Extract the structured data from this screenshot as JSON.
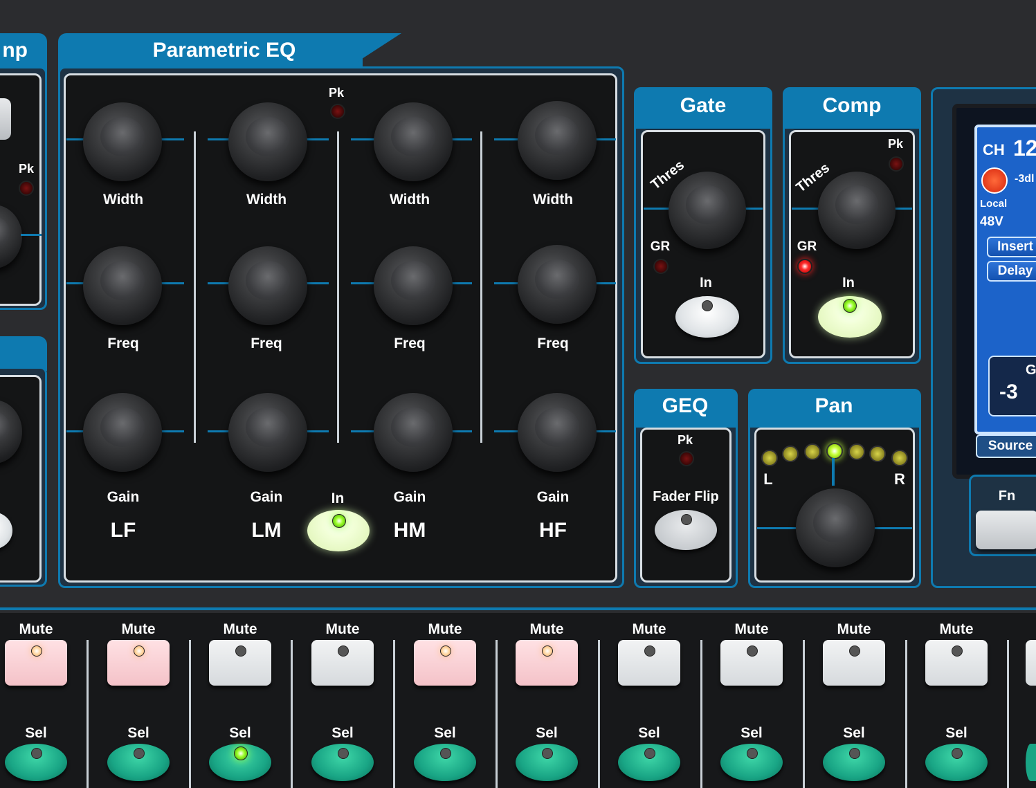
{
  "left_section": {
    "title_fragment": "np",
    "pk_label": "Pk"
  },
  "parametric_eq": {
    "title": "Parametric EQ",
    "pk_label": "Pk",
    "in_label": "In",
    "bands": [
      {
        "name": "LF",
        "width_label": "Width",
        "freq_label": "Freq",
        "gain_label": "Gain"
      },
      {
        "name": "LM",
        "width_label": "Width",
        "freq_label": "Freq",
        "gain_label": "Gain"
      },
      {
        "name": "HM",
        "width_label": "Width",
        "freq_label": "Freq",
        "gain_label": "Gain"
      },
      {
        "name": "HF",
        "width_label": "Width",
        "freq_label": "Freq",
        "gain_label": "Gain"
      }
    ]
  },
  "gate": {
    "title": "Gate",
    "thres_label": "Thres",
    "gr_label": "GR",
    "in_label": "In"
  },
  "comp": {
    "title": "Comp",
    "pk_label": "Pk",
    "thres_label": "Thres",
    "gr_label": "GR",
    "in_label": "In"
  },
  "geq": {
    "title": "GEQ",
    "pk_label": "Pk",
    "fader_flip_label": "Fader Flip"
  },
  "pan": {
    "title": "Pan",
    "left_label": "L",
    "right_label": "R",
    "meter_leds": 7,
    "active_led": 4
  },
  "display": {
    "ch_label": "CH",
    "ch_number": "12",
    "gain_readout": "-3dl",
    "local_label": "Local",
    "phantom_label": "48V",
    "insert_label": "Insert",
    "delay_label": "Delay",
    "gain_label": "Ga",
    "gain_value": "-3",
    "source_label": "Source",
    "fn_label": "Fn",
    "colors": {
      "lcd_bg": "#1c63c9",
      "knob": "#e2391a"
    }
  },
  "strips": [
    {
      "mute_label": "Mute",
      "sel_label": "Sel",
      "mute_on": true,
      "sel_on": false
    },
    {
      "mute_label": "Mute",
      "sel_label": "Sel",
      "mute_on": true,
      "sel_on": false
    },
    {
      "mute_label": "Mute",
      "sel_label": "Sel",
      "mute_on": false,
      "sel_on": true
    },
    {
      "mute_label": "Mute",
      "sel_label": "Sel",
      "mute_on": false,
      "sel_on": false
    },
    {
      "mute_label": "Mute",
      "sel_label": "Sel",
      "mute_on": true,
      "sel_on": false
    },
    {
      "mute_label": "Mute",
      "sel_label": "Sel",
      "mute_on": true,
      "sel_on": false
    },
    {
      "mute_label": "Mute",
      "sel_label": "Sel",
      "mute_on": false,
      "sel_on": false
    },
    {
      "mute_label": "Mute",
      "sel_label": "Sel",
      "mute_on": false,
      "sel_on": false
    },
    {
      "mute_label": "Mute",
      "sel_label": "Sel",
      "mute_on": false,
      "sel_on": false
    },
    {
      "mute_label": "Mute",
      "sel_label": "Sel",
      "mute_on": false,
      "sel_on": false
    }
  ],
  "colors": {
    "panel": "#2b2c2f",
    "accent": "#0e7ab0",
    "mute_on": "#f4c2c8",
    "sel": "#19a585"
  }
}
